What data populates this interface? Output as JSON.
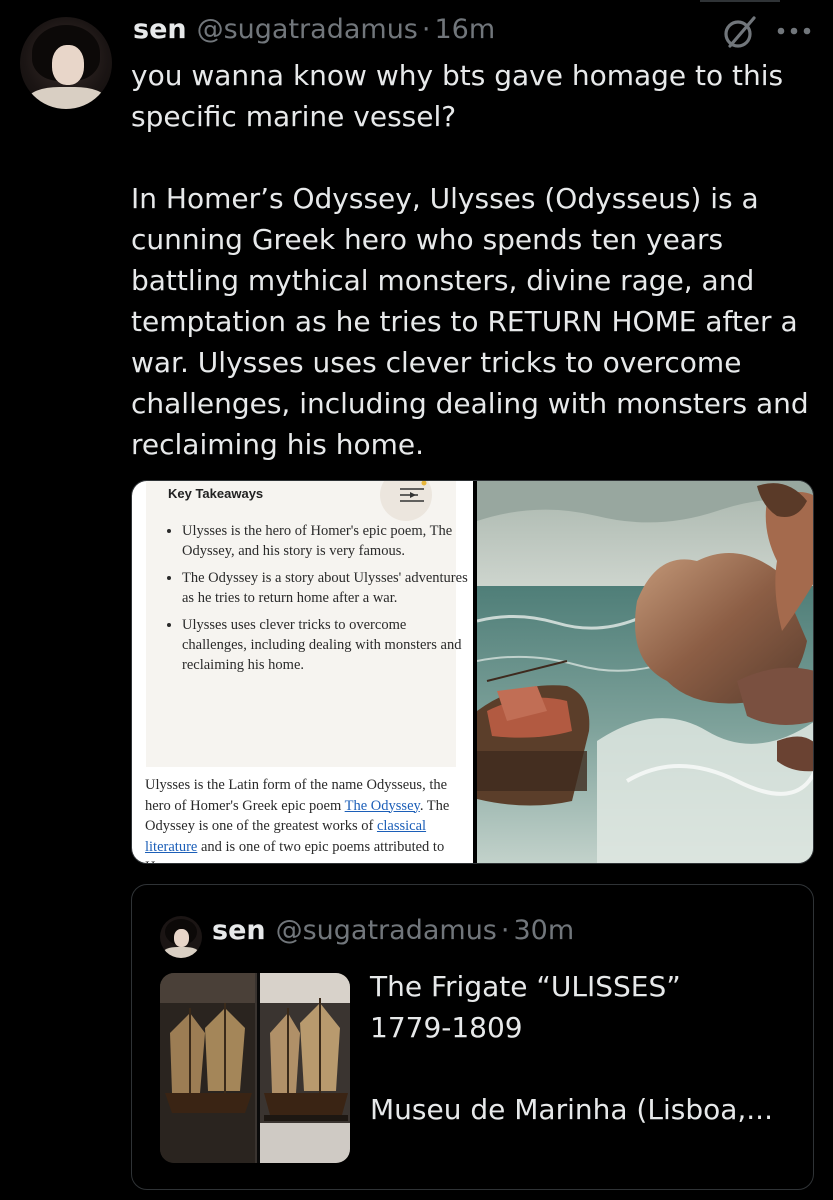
{
  "tweet": {
    "author_name": "sen",
    "author_handle": "@sugatradamus",
    "timestamp": "16m",
    "separator": "·",
    "body_paragraph_1": "you wanna know why bts gave homage to this specific marine vessel?",
    "body_paragraph_2": "In Homer’s Odyssey, Ulysses (Odysseus) is a cunning Greek hero who spends ten years battling mythical monsters, divine rage, and temptation as he tries to RETURN HOME after a war. Ulysses uses clever tricks to overcome challenges, including dealing with monsters and reclaiming his home.",
    "icons": [
      "grok-icon",
      "more-icon"
    ]
  },
  "media_left": {
    "takeaways_title": "Key Takeaways",
    "takeaways": [
      "Ulysses is the hero of Homer's epic poem, The Odyssey, and his story is very famous.",
      "The Odyssey is a story about Ulysses' adventures as he tries to return home after a war.",
      "Ulysses uses clever tricks to overcome challenges, including dealing with monsters and reclaiming his home."
    ],
    "article_part_1": "Ulysses is the Latin form of the name Odysseus, the hero of Homer's Greek epic poem ",
    "article_link_1": "The Odyssey",
    "article_part_2": ". The Odyssey is one of the greatest works of ",
    "article_link_2": "classical literature",
    "article_part_3": " and is one of two epic poems attributed to Homer",
    "link_color": "#1c5fb8"
  },
  "quoted_tweet": {
    "author_name": "sen",
    "author_handle": "@sugatradamus",
    "timestamp": "30m",
    "separator": "·",
    "line_1": "The Frigate “ULISSES”",
    "line_2": "1779-1809",
    "line_3": "Museu de Marinha (Lisboa,..."
  },
  "colors": {
    "background": "#000000",
    "text_primary": "#e7e9ea",
    "text_secondary": "#71767b",
    "border": "#2f3336"
  }
}
